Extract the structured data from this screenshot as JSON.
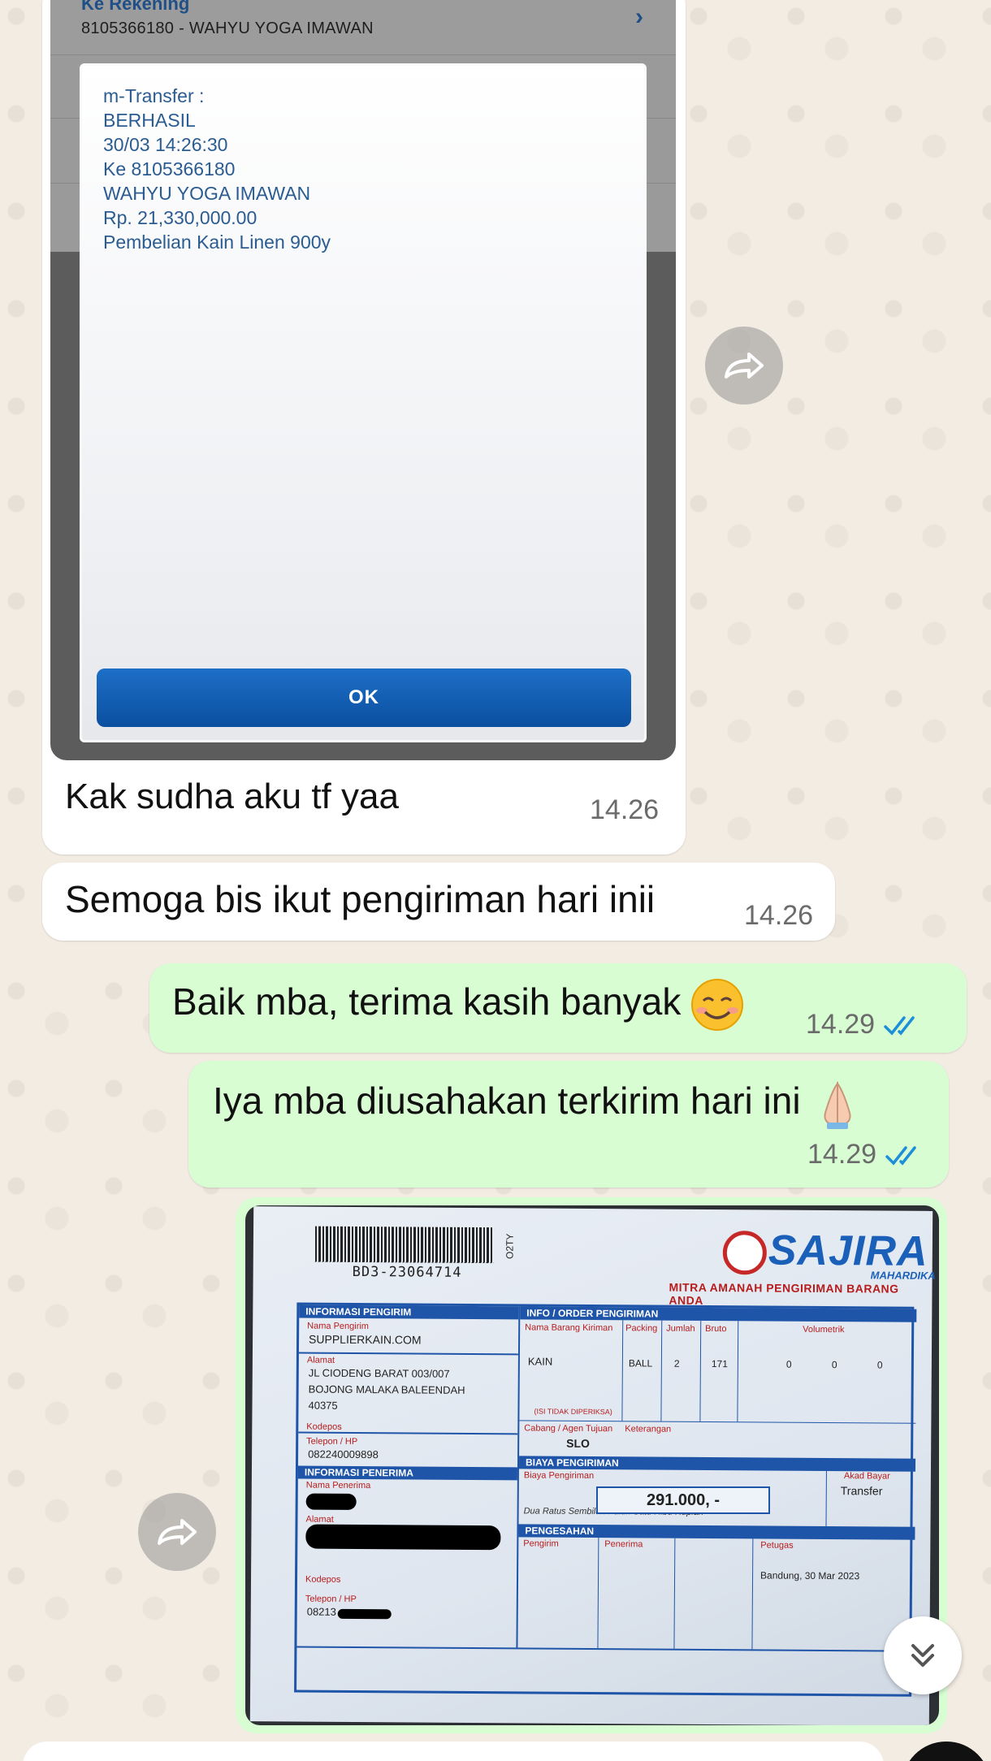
{
  "incoming_image_message": {
    "screenshot": {
      "account_label": "Ke Rekening",
      "account_value": "8105366180 - WAHYU YOGA IMAWAN",
      "dialog_lines": [
        "m-Transfer :",
        "BERHASIL",
        "30/03 14:26:30",
        "Ke 8105366180",
        "WAHYU YOGA IMAWAN",
        "Rp. 21,330,000.00",
        "Pembelian Kain Linen 900y"
      ],
      "ok_label": "OK"
    },
    "caption": "Kak sudha aku tf yaa",
    "time": "14.26"
  },
  "incoming_text_message": {
    "text": "Semoga bis ikut pengiriman hari inii",
    "time": "14.26"
  },
  "outgoing_messages": [
    {
      "text": "Baik mba, terima kasih banyak",
      "emoji": "smiling-face-emoji",
      "time": "14.29",
      "status": "read"
    },
    {
      "text": "Iya mba diusahakan terkirim hari ini",
      "emoji": "folded-hands-emoji",
      "time": "14.29",
      "status": "read"
    }
  ],
  "receipt_image": {
    "barcode_number": "BD3-23064714",
    "barcode_side": "O2TY",
    "brand": "SAJIRA",
    "brand_sub": "MAHARDIKA",
    "tagline": "MITRA AMANAH PENGIRIMAN BARANG ANDA",
    "sections": {
      "sender_head": "INFORMASI PENGIRIM",
      "sender_name_label": "Nama Pengirim",
      "sender_name": "SUPPLIERKAIN.COM",
      "address_label": "Alamat",
      "address_lines": [
        "JL CIODENG BARAT 003/007",
        "BOJONG MALAKA BALEENDAH",
        "40375"
      ],
      "kodepos_label": "Kodepos",
      "phone_label": "Telepon / HP",
      "phone": "082240009898",
      "receiver_head": "INFORMASI PENERIMA",
      "receiver_name_label": "Nama Penerima",
      "receiver_address_label": "Alamat",
      "receiver_kodepos_label": "Kodepos",
      "receiver_phone_label": "Telepon / HP",
      "receiver_phone_partial": "08213",
      "order_head": "INFO / ORDER PENGIRIMAN",
      "item_label": "Nama Barang Kiriman",
      "item": "KAIN",
      "packing_label": "Packing",
      "packing": "BALL",
      "qty_label": "Jumlah",
      "qty": "2",
      "bruto_label": "Bruto",
      "bruto": "171",
      "vol_label": "Volumetrik",
      "vol_values": [
        "0",
        "0",
        "0"
      ],
      "not_checked": "(ISI TIDAK DIPERIKSA)",
      "branch_label": "Cabang / Agen Tujuan",
      "branch": "SLO",
      "note_label": "Keterangan",
      "cost_head": "BIAYA PENGIRIMAN",
      "cost_label": "Biaya Pengiriman",
      "cost": "291.000, -",
      "terbilang": "Dua Ratus Sembilan Puluh Satu Ribu Rupiah",
      "pay_label": "Akad Bayar",
      "pay": "Transfer",
      "approval_head": "PENGESAHAN",
      "sender_sign": "Pengirim",
      "receiver_sign": "Penerima",
      "officer": "Petugas",
      "place_date": "Bandung, 30 Mar 2023"
    }
  }
}
